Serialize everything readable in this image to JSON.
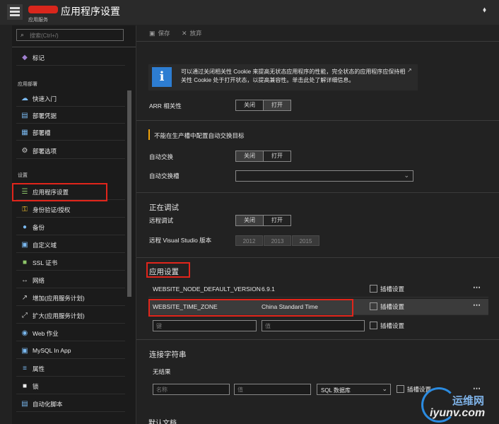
{
  "window": {
    "title": "应用程序设置",
    "subtitle": "应用服务",
    "pin_glyph": "📌"
  },
  "search": {
    "placeholder": "搜索(Ctrl+/)"
  },
  "nav": {
    "top_item": {
      "label": "标记",
      "icon": "tag-icon"
    },
    "sections": [
      {
        "title": "应用部署",
        "items": [
          {
            "label": "快速入门",
            "icon": "cloud-icon"
          },
          {
            "label": "部署凭据",
            "icon": "credentials-icon"
          },
          {
            "label": "部署槽",
            "icon": "slots-icon"
          },
          {
            "label": "部署选项",
            "icon": "gear-icon"
          }
        ]
      },
      {
        "title": "设置",
        "items": [
          {
            "label": "应用程序设置",
            "icon": "list-icon",
            "active": true
          },
          {
            "label": "身份验证/授权",
            "icon": "key-icon"
          },
          {
            "label": "备份",
            "icon": "backup-icon"
          },
          {
            "label": "自定义域",
            "icon": "domain-icon"
          },
          {
            "label": "SSL 证书",
            "icon": "ssl-icon"
          },
          {
            "label": "网络",
            "icon": "network-icon"
          },
          {
            "label": "增加(应用服务计划)",
            "icon": "scale-up-icon"
          },
          {
            "label": "扩大(应用服务计划)",
            "icon": "scale-out-icon"
          },
          {
            "label": "Web 作业",
            "icon": "webjob-icon"
          },
          {
            "label": "MySQL In App",
            "icon": "mysql-icon"
          },
          {
            "label": "属性",
            "icon": "properties-icon"
          },
          {
            "label": "锁",
            "icon": "lock-icon"
          },
          {
            "label": "自动化脚本",
            "icon": "script-icon"
          }
        ]
      }
    ]
  },
  "toolbar": {
    "save_label": "保存",
    "discard_label": "放弃"
  },
  "info": {
    "text": "可以通过关闭相关性 Cookie 来提高无状态应用程序的性能，完全状态的应用程序应保持相关性 Cookie 处于打开状态，以提高兼容性。单击此处了解详细信息。"
  },
  "toggles": {
    "off": "关闭",
    "on": "打开"
  },
  "arr": {
    "label": "ARR 相关性",
    "value": "on"
  },
  "warning": {
    "text": "不能在生产槽中配置自动交换目标"
  },
  "auto_swap": {
    "label": "自动交换",
    "value": "off",
    "slot_label": "自动交换槽",
    "slot_value": ""
  },
  "debug": {
    "heading": "正在调试",
    "remote_label": "远程调试",
    "remote_value": "off",
    "vs_label": "远程 Visual Studio 版本",
    "versions": [
      "2012",
      "2013",
      "2015"
    ]
  },
  "app_settings": {
    "heading": "应用设置",
    "rows": [
      {
        "key": "WEBSITE_NODE_DEFAULT_VERSION",
        "value": "6.9.1",
        "slot_label": "插槽设置"
      },
      {
        "key": "WEBSITE_TIME_ZONE",
        "value": "China Standard Time",
        "slot_label": "插槽设置"
      }
    ],
    "new_row": {
      "key_placeholder": "键",
      "value_placeholder": "值",
      "slot_label": "插槽设置"
    }
  },
  "conn_strings": {
    "heading": "连接字符串",
    "empty": "无结果",
    "name_placeholder": "名称",
    "value_placeholder": "值",
    "type_selected": "SQL 数据库",
    "slot_label": "插槽设置"
  },
  "cutoff_heading": "默认文档",
  "watermark": {
    "cn": "运维网",
    "url": "iyunv.com"
  },
  "colors": {
    "accent": "#2d7dd2",
    "highlight": "#e1251b",
    "warning": "#f0a30a"
  }
}
